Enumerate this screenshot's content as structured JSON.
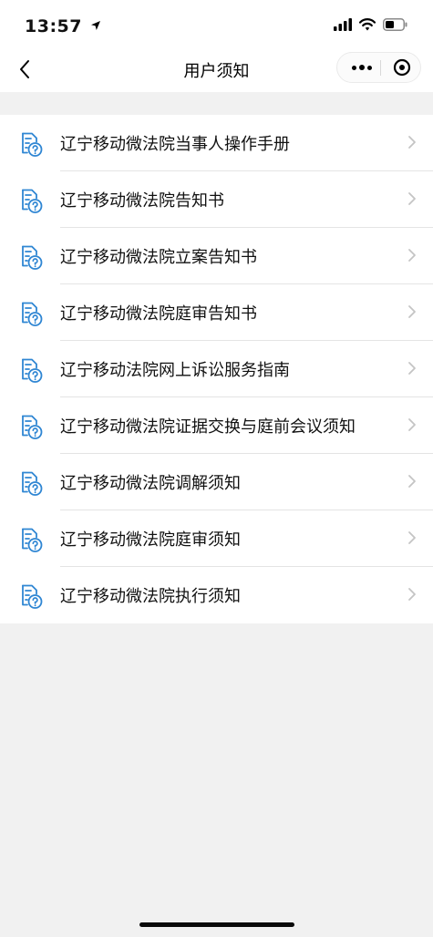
{
  "status_bar": {
    "time": "13:57"
  },
  "nav": {
    "title": "用户须知"
  },
  "items": [
    {
      "label": "辽宁移动微法院当事人操作手册"
    },
    {
      "label": "辽宁移动微法院告知书"
    },
    {
      "label": "辽宁移动微法院立案告知书"
    },
    {
      "label": "辽宁移动微法院庭审告知书"
    },
    {
      "label": "辽宁移动法院网上诉讼服务指南"
    },
    {
      "label": "辽宁移动微法院证据交换与庭前会议须知"
    },
    {
      "label": "辽宁移动微法院调解须知"
    },
    {
      "label": "辽宁移动微法院庭审须知"
    },
    {
      "label": "辽宁移动微法院执行须知"
    }
  ],
  "colors": {
    "icon_blue": "#2f86d3",
    "background": "#f1f1f1",
    "chevron": "#c4c4c4"
  },
  "icons": [
    "location-arrow-icon",
    "signal-icon",
    "wifi-icon",
    "battery-icon",
    "back-arrow-icon",
    "more-icon",
    "close-target-icon",
    "document-help-icon",
    "chevron-right-icon"
  ]
}
